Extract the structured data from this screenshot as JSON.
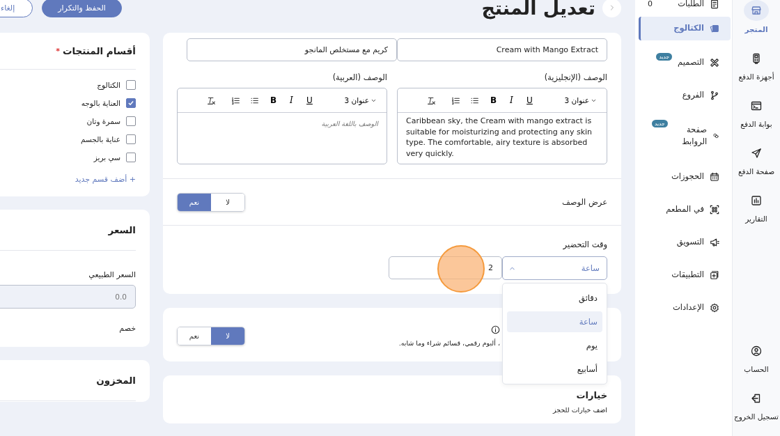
{
  "header": {
    "title": "تعديل المنتج",
    "buttons": [
      {
        "label": "الحفظ والتكرار",
        "kind": "primary"
      },
      {
        "label": "إلغاء",
        "kind": "outline"
      }
    ]
  },
  "rail": {
    "items": [
      {
        "label": "المتجر",
        "selected": true
      },
      {
        "label": "أجهزة الدفع",
        "selected": false
      },
      {
        "label": "بوابة الدفع",
        "selected": false
      },
      {
        "label": "صفحة الدفع",
        "selected": false
      },
      {
        "label": "التقارير",
        "selected": false
      }
    ],
    "bottom": [
      {
        "label": "الحساب"
      },
      {
        "label": "تسجيل الخروج"
      }
    ]
  },
  "menu": [
    {
      "label": "الطلبات",
      "count": "0",
      "selected": false
    },
    {
      "label": "الكتالوج",
      "selected": true
    },
    {
      "label": "التصميم",
      "badge": "جديد",
      "selected": false
    },
    {
      "label": "الفروع",
      "selected": false
    },
    {
      "label": "صفحة الروابط",
      "badge": "جديد",
      "selected": false
    },
    {
      "label": "الحجوزات",
      "selected": false
    },
    {
      "label": "في المطعم",
      "selected": false
    },
    {
      "label": "التسويق",
      "selected": false
    },
    {
      "label": "التطبيقات",
      "selected": false
    },
    {
      "label": "الإعدادات",
      "selected": false
    }
  ],
  "product": {
    "names": [
      {
        "value": "Cream with Mango Extract"
      },
      {
        "value": "كريم مع مستخلص المانجو"
      }
    ],
    "editors": [
      {
        "label": "الوصف (الإنجليزية)",
        "heading": "عنوان 3",
        "buttons": [
          "U",
          "I",
          "B"
        ],
        "text": "Caribbean sky, the Cream with mango extract is suitable for moisturizing and protecting any skin type. The comfortable, airy texture is absorbed very quickly."
      },
      {
        "label": "الوصف (العربية)",
        "heading": "عنوان 3",
        "buttons": [
          "U",
          "I",
          "B"
        ],
        "placeholder": "الوصف باللغة العربية"
      }
    ],
    "show_description": {
      "label": "عرض الوصف",
      "options": [
        {
          "label": "لا",
          "selected": false
        },
        {
          "label": "نعم",
          "selected": true
        }
      ]
    },
    "prep_time": {
      "label": "وقت التحضير",
      "unit": "ساعة",
      "open": true,
      "value": "2",
      "options": [
        {
          "label": "دقائق",
          "selected": false
        },
        {
          "label": "ساعة",
          "selected": true
        },
        {
          "label": "يوم",
          "selected": false
        },
        {
          "label": "أسابيع",
          "selected": false
        }
      ]
    }
  },
  "digital": {
    "text": "، ألبوم رقمي، قسائم شراء وما شابه.",
    "options": [
      {
        "label": "لا",
        "selected": true
      },
      {
        "label": "نعم",
        "selected": false
      }
    ]
  },
  "options_card": {
    "title": "خيارات",
    "subtitle": "اضف خيارات للحجز"
  },
  "categories": {
    "title": "أقسام المنتجات",
    "required_mark": "*",
    "items": [
      {
        "label": "الكتالوج",
        "checked": false
      },
      {
        "label": "العناية بالوجه",
        "checked": true
      },
      {
        "label": "سمرة وتان",
        "checked": false
      },
      {
        "label": "عناية بالجسم",
        "checked": false
      },
      {
        "label": "سي بريز",
        "checked": false
      }
    ],
    "add_link": "+ أضف قسم جديد"
  },
  "price": {
    "title": "السعر",
    "regular_label": "السعر الطبيعي",
    "regular_placeholder": "0.0",
    "discount_label": "خصم"
  },
  "inventory": {
    "title": "المخزون"
  }
}
